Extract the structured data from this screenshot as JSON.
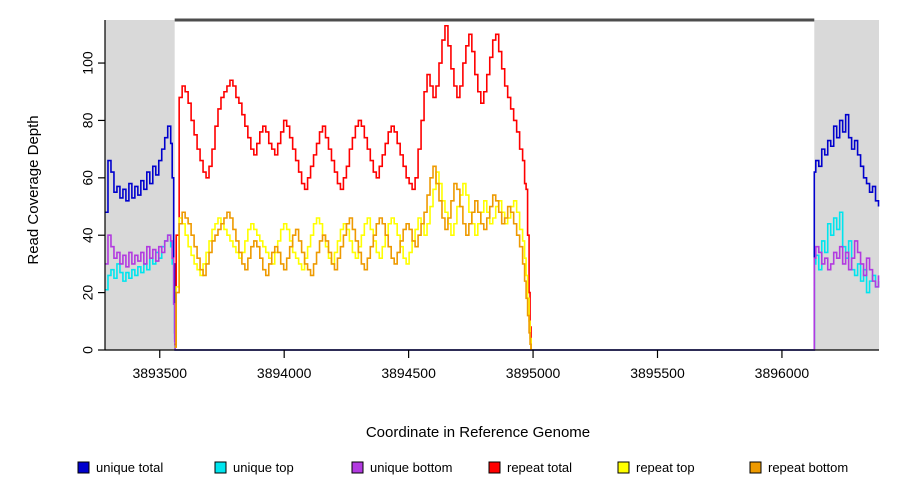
{
  "chart_data": {
    "type": "line",
    "title": "",
    "xlabel": "Coordinate in Reference Genome",
    "ylabel": "Read Coverage Depth",
    "xlim": [
      3893280,
      3896390
    ],
    "ylim": [
      0,
      115
    ],
    "xticks": [
      3893500,
      3894000,
      3894500,
      3895000,
      3895500,
      3896000
    ],
    "xticklabels": [
      "3893500",
      "3894000",
      "3894500",
      "3895000",
      "3895500",
      "3896000"
    ],
    "yticks": [
      0,
      20,
      40,
      60,
      80,
      100
    ],
    "yticklabels": [
      "0",
      "20",
      "40",
      "60",
      "80",
      "100"
    ],
    "grid": false,
    "legend_position": "bottom",
    "shaded_regions": [
      {
        "x0": 3893280,
        "x1": 3893560,
        "color": "#d9d9d9",
        "label": "flanking-unique-left"
      },
      {
        "x0": 3896130,
        "x1": 3896390,
        "color": "#d9d9d9",
        "label": "flanking-unique-right"
      }
    ],
    "repeat_span_marker": {
      "x0": 3893560,
      "x1": 3896130,
      "color": "#4d4d4d",
      "y": 115
    },
    "series": [
      {
        "name": "unique total",
        "color": "#0000cd",
        "x": [
          3893280,
          3893292,
          3893304,
          3893316,
          3893328,
          3893340,
          3893352,
          3893364,
          3893376,
          3893388,
          3893400,
          3893412,
          3893424,
          3893436,
          3893448,
          3893460,
          3893472,
          3893484,
          3893496,
          3893508,
          3893520,
          3893532,
          3893544,
          3893550,
          3893556,
          3893560,
          3893562,
          3896128,
          3896130,
          3896136,
          3896148,
          3896160,
          3896172,
          3896184,
          3896196,
          3896208,
          3896220,
          3896232,
          3896244,
          3896256,
          3896268,
          3896280,
          3896292,
          3896304,
          3896316,
          3896328,
          3896340,
          3896352,
          3896364,
          3896376,
          3896388
        ],
        "y": [
          48,
          66,
          62,
          55,
          57,
          53,
          56,
          52,
          58,
          53,
          57,
          54,
          59,
          56,
          62,
          58,
          64,
          61,
          66,
          70,
          74,
          78,
          72,
          60,
          30,
          6,
          0,
          0,
          62,
          66,
          64,
          70,
          68,
          73,
          71,
          78,
          74,
          80,
          76,
          82,
          74,
          70,
          73,
          68,
          64,
          60,
          58,
          55,
          57,
          52,
          50
        ]
      },
      {
        "name": "unique top",
        "color": "#00e5ee",
        "x": [
          3893280,
          3893292,
          3893304,
          3893316,
          3893328,
          3893340,
          3893352,
          3893364,
          3893376,
          3893388,
          3893400,
          3893412,
          3893424,
          3893436,
          3893448,
          3893460,
          3893472,
          3893484,
          3893496,
          3893508,
          3893520,
          3893532,
          3893544,
          3893550,
          3893556,
          3893560,
          3893562,
          3896128,
          3896130,
          3896136,
          3896148,
          3896160,
          3896172,
          3896184,
          3896196,
          3896208,
          3896220,
          3896232,
          3896244,
          3896256,
          3896268,
          3896280,
          3896292,
          3896304,
          3896316,
          3896328,
          3896340,
          3896352,
          3896364,
          3896376,
          3896388
        ],
        "y": [
          21,
          26,
          28,
          25,
          30,
          27,
          24,
          27,
          25,
          28,
          26,
          29,
          27,
          30,
          28,
          32,
          30,
          34,
          32,
          36,
          38,
          40,
          36,
          30,
          16,
          4,
          0,
          0,
          30,
          33,
          28,
          38,
          34,
          44,
          40,
          46,
          42,
          48,
          36,
          32,
          38,
          28,
          26,
          30,
          24,
          28,
          20,
          24,
          26,
          22,
          24
        ]
      },
      {
        "name": "unique bottom",
        "color": "#b23ae0",
        "x": [
          3893280,
          3893292,
          3893304,
          3893316,
          3893328,
          3893340,
          3893352,
          3893364,
          3893376,
          3893388,
          3893400,
          3893412,
          3893424,
          3893436,
          3893448,
          3893460,
          3893472,
          3893484,
          3893496,
          3893508,
          3893520,
          3893532,
          3893544,
          3893550,
          3893556,
          3893560,
          3893562,
          3896128,
          3896130,
          3896136,
          3896148,
          3896160,
          3896172,
          3896184,
          3896196,
          3896208,
          3896220,
          3896232,
          3896244,
          3896256,
          3896268,
          3896280,
          3896292,
          3896304,
          3896316,
          3896328,
          3896340,
          3896352,
          3896364,
          3896376,
          3896388
        ],
        "y": [
          30,
          40,
          36,
          32,
          34,
          30,
          33,
          29,
          34,
          30,
          33,
          31,
          34,
          30,
          36,
          32,
          35,
          31,
          36,
          34,
          38,
          40,
          38,
          32,
          16,
          3,
          0,
          0,
          32,
          36,
          34,
          30,
          32,
          28,
          30,
          34,
          32,
          36,
          30,
          34,
          28,
          32,
          38,
          34,
          30,
          26,
          32,
          28,
          24,
          22,
          26
        ]
      },
      {
        "name": "repeat total",
        "color": "#ff0000",
        "x": [
          3893560,
          3893566,
          3893578,
          3893590,
          3893602,
          3893614,
          3893626,
          3893638,
          3893650,
          3893662,
          3893674,
          3893686,
          3893698,
          3893710,
          3893722,
          3893734,
          3893746,
          3893758,
          3893770,
          3893782,
          3893794,
          3893806,
          3893818,
          3893830,
          3893842,
          3893854,
          3893866,
          3893878,
          3893890,
          3893902,
          3893914,
          3893926,
          3893938,
          3893950,
          3893962,
          3893974,
          3893986,
          3893998,
          3894010,
          3894022,
          3894034,
          3894046,
          3894058,
          3894070,
          3894082,
          3894094,
          3894106,
          3894118,
          3894130,
          3894142,
          3894154,
          3894166,
          3894178,
          3894190,
          3894202,
          3894214,
          3894226,
          3894238,
          3894250,
          3894262,
          3894274,
          3894286,
          3894298,
          3894310,
          3894322,
          3894334,
          3894346,
          3894358,
          3894370,
          3894382,
          3894394,
          3894406,
          3894418,
          3894430,
          3894442,
          3894454,
          3894466,
          3894478,
          3894490,
          3894502,
          3894514,
          3894526,
          3894538,
          3894550,
          3894562,
          3894574,
          3894586,
          3894598,
          3894610,
          3894622,
          3894634,
          3894646,
          3894658,
          3894670,
          3894682,
          3894694,
          3894706,
          3894718,
          3894730,
          3894742,
          3894754,
          3894766,
          3894778,
          3894790,
          3894802,
          3894814,
          3894826,
          3894838,
          3894850,
          3894862,
          3894874,
          3894886,
          3894898,
          3894910,
          3894922,
          3894934,
          3894946,
          3894958,
          3894966,
          3894972,
          3894978,
          3894984,
          3894988,
          3894992
        ],
        "y": [
          2,
          40,
          88,
          92,
          90,
          86,
          80,
          75,
          70,
          66,
          62,
          60,
          64,
          70,
          78,
          84,
          88,
          90,
          92,
          94,
          92,
          88,
          86,
          82,
          78,
          74,
          70,
          68,
          72,
          76,
          78,
          76,
          72,
          70,
          68,
          72,
          76,
          80,
          78,
          74,
          70,
          66,
          62,
          58,
          56,
          60,
          64,
          68,
          72,
          76,
          78,
          74,
          70,
          66,
          62,
          58,
          56,
          60,
          64,
          70,
          74,
          78,
          80,
          78,
          74,
          70,
          66,
          62,
          60,
          64,
          68,
          72,
          76,
          78,
          76,
          72,
          68,
          64,
          60,
          58,
          56,
          60,
          70,
          80,
          90,
          96,
          92,
          88,
          92,
          100,
          108,
          113,
          106,
          98,
          92,
          88,
          92,
          100,
          106,
          110,
          104,
          96,
          90,
          86,
          90,
          96,
          102,
          108,
          110,
          104,
          98,
          92,
          88,
          84,
          80,
          76,
          70,
          66,
          58,
          56,
          40,
          20,
          8,
          0
        ]
      },
      {
        "name": "repeat top",
        "color": "#ffff00",
        "x": [
          3893560,
          3893566,
          3893578,
          3893590,
          3893602,
          3893614,
          3893626,
          3893638,
          3893650,
          3893662,
          3893674,
          3893686,
          3893698,
          3893710,
          3893722,
          3893734,
          3893746,
          3893758,
          3893770,
          3893782,
          3893794,
          3893806,
          3893818,
          3893830,
          3893842,
          3893854,
          3893866,
          3893878,
          3893890,
          3893902,
          3893914,
          3893926,
          3893938,
          3893950,
          3893962,
          3893974,
          3893986,
          3893998,
          3894010,
          3894022,
          3894034,
          3894046,
          3894058,
          3894070,
          3894082,
          3894094,
          3894106,
          3894118,
          3894130,
          3894142,
          3894154,
          3894166,
          3894178,
          3894190,
          3894202,
          3894214,
          3894226,
          3894238,
          3894250,
          3894262,
          3894274,
          3894286,
          3894298,
          3894310,
          3894322,
          3894334,
          3894346,
          3894358,
          3894370,
          3894382,
          3894394,
          3894406,
          3894418,
          3894430,
          3894442,
          3894454,
          3894466,
          3894478,
          3894490,
          3894502,
          3894514,
          3894526,
          3894538,
          3894550,
          3894562,
          3894574,
          3894586,
          3894598,
          3894610,
          3894622,
          3894634,
          3894646,
          3894658,
          3894670,
          3894682,
          3894694,
          3894706,
          3894718,
          3894730,
          3894742,
          3894754,
          3894766,
          3894778,
          3894790,
          3894802,
          3894814,
          3894826,
          3894838,
          3894850,
          3894862,
          3894874,
          3894886,
          3894898,
          3894910,
          3894922,
          3894934,
          3894946,
          3894958,
          3894966,
          3894972,
          3894978,
          3894984,
          3894988,
          3894992
        ],
        "y": [
          1,
          22,
          46,
          44,
          40,
          36,
          33,
          30,
          28,
          26,
          30,
          34,
          38,
          42,
          44,
          46,
          44,
          42,
          40,
          38,
          36,
          34,
          32,
          34,
          38,
          42,
          44,
          42,
          40,
          38,
          36,
          34,
          32,
          30,
          34,
          38,
          42,
          44,
          42,
          38,
          34,
          32,
          30,
          28,
          32,
          36,
          40,
          44,
          46,
          44,
          40,
          36,
          32,
          30,
          34,
          38,
          42,
          44,
          42,
          38,
          34,
          32,
          36,
          40,
          44,
          46,
          42,
          38,
          34,
          32,
          36,
          40,
          44,
          46,
          44,
          40,
          36,
          32,
          30,
          34,
          38,
          42,
          46,
          44,
          40,
          44,
          50,
          56,
          62,
          58,
          52,
          48,
          44,
          40,
          44,
          50,
          54,
          58,
          54,
          48,
          44,
          40,
          44,
          48,
          52,
          48,
          44,
          46,
          50,
          52,
          48,
          44,
          46,
          50,
          52,
          48,
          42,
          38,
          32,
          26,
          18,
          10,
          4,
          0
        ]
      },
      {
        "name": "repeat bottom",
        "color": "#ee9a00",
        "x": [
          3893560,
          3893566,
          3893578,
          3893590,
          3893602,
          3893614,
          3893626,
          3893638,
          3893650,
          3893662,
          3893674,
          3893686,
          3893698,
          3893710,
          3893722,
          3893734,
          3893746,
          3893758,
          3893770,
          3893782,
          3893794,
          3893806,
          3893818,
          3893830,
          3893842,
          3893854,
          3893866,
          3893878,
          3893890,
          3893902,
          3893914,
          3893926,
          3893938,
          3893950,
          3893962,
          3893974,
          3893986,
          3893998,
          3894010,
          3894022,
          3894034,
          3894046,
          3894058,
          3894070,
          3894082,
          3894094,
          3894106,
          3894118,
          3894130,
          3894142,
          3894154,
          3894166,
          3894178,
          3894190,
          3894202,
          3894214,
          3894226,
          3894238,
          3894250,
          3894262,
          3894274,
          3894286,
          3894298,
          3894310,
          3894322,
          3894334,
          3894346,
          3894358,
          3894370,
          3894382,
          3894394,
          3894406,
          3894418,
          3894430,
          3894442,
          3894454,
          3894466,
          3894478,
          3894490,
          3894502,
          3894514,
          3894526,
          3894538,
          3894550,
          3894562,
          3894574,
          3894586,
          3894598,
          3894610,
          3894622,
          3894634,
          3894646,
          3894658,
          3894670,
          3894682,
          3894694,
          3894706,
          3894718,
          3894730,
          3894742,
          3894754,
          3894766,
          3894778,
          3894790,
          3894802,
          3894814,
          3894826,
          3894838,
          3894850,
          3894862,
          3894874,
          3894886,
          3894898,
          3894910,
          3894922,
          3894934,
          3894946,
          3894958,
          3894966,
          3894972,
          3894978,
          3894984,
          3894988,
          3894992
        ],
        "y": [
          1,
          20,
          44,
          48,
          46,
          44,
          40,
          36,
          32,
          28,
          26,
          30,
          34,
          38,
          40,
          42,
          44,
          46,
          48,
          46,
          42,
          38,
          34,
          30,
          28,
          32,
          36,
          38,
          36,
          32,
          28,
          26,
          30,
          34,
          36,
          34,
          30,
          28,
          32,
          36,
          40,
          42,
          38,
          34,
          30,
          28,
          26,
          30,
          34,
          38,
          40,
          38,
          34,
          30,
          28,
          32,
          36,
          40,
          44,
          46,
          42,
          38,
          34,
          30,
          28,
          32,
          36,
          40,
          44,
          46,
          44,
          40,
          36,
          32,
          30,
          34,
          38,
          42,
          44,
          42,
          38,
          36,
          40,
          44,
          48,
          54,
          60,
          64,
          58,
          52,
          46,
          42,
          46,
          52,
          58,
          56,
          50,
          44,
          40,
          44,
          48,
          52,
          48,
          44,
          42,
          46,
          50,
          54,
          52,
          48,
          44,
          46,
          50,
          48,
          44,
          40,
          36,
          30,
          24,
          18,
          12,
          6,
          2,
          0
        ]
      }
    ],
    "legend": [
      {
        "label": "unique total",
        "color": "#0000cd"
      },
      {
        "label": "unique top",
        "color": "#00e5ee"
      },
      {
        "label": "unique bottom",
        "color": "#b23ae0"
      },
      {
        "label": "repeat total",
        "color": "#ff0000"
      },
      {
        "label": "repeat top",
        "color": "#ffff00"
      },
      {
        "label": "repeat bottom",
        "color": "#ee9a00"
      }
    ]
  }
}
